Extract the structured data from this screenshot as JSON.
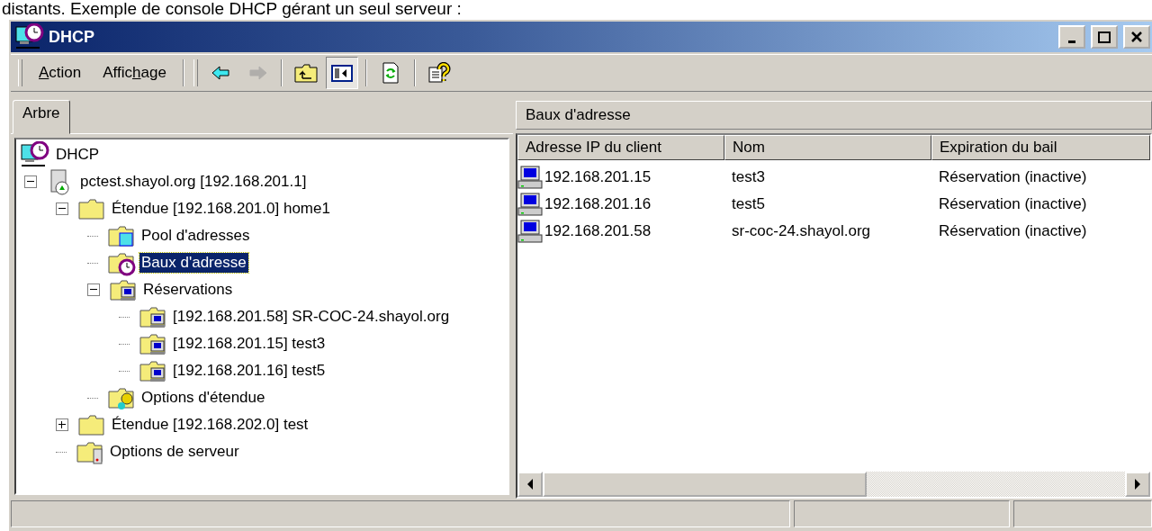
{
  "caption": "distants. Exemple de console DHCP gérant un seul serveur :",
  "window": {
    "title": "DHCP",
    "controls": [
      {
        "kind": "minimize"
      },
      {
        "kind": "maximize"
      },
      {
        "kind": "close"
      }
    ]
  },
  "menu": [
    {
      "key": "A",
      "after": "ction"
    },
    {
      "before": "Affic",
      "key": "h",
      "after": "age"
    }
  ],
  "toolbar": [
    {
      "buttons": [
        {
          "kind": "back",
          "disabled": false,
          "pressed": false
        },
        {
          "kind": "forward",
          "disabled": true,
          "pressed": false
        }
      ]
    },
    {
      "buttons": [
        {
          "kind": "up",
          "disabled": false,
          "pressed": false
        },
        {
          "kind": "tree-toggle",
          "disabled": false,
          "pressed": true
        }
      ]
    },
    {
      "buttons": [
        {
          "kind": "refresh",
          "disabled": false,
          "pressed": false
        }
      ]
    },
    {
      "buttons": [
        {
          "kind": "help",
          "disabled": false,
          "pressed": false
        }
      ]
    }
  ],
  "tabs": [
    {
      "label": "Arbre",
      "selected": true
    }
  ],
  "tree": [
    {
      "label": "DHCP",
      "kind": "dhcp",
      "selected": false,
      "children": [
        {
          "label": "pctest.shayol.org [192.168.201.1]",
          "kind": "server",
          "selected": false,
          "expanded": true,
          "children": [
            {
              "label": "Étendue [192.168.201.0] home1",
              "kind": "folder",
              "selected": false,
              "expanded": true,
              "children": [
                {
                  "label": "Pool d'adresses",
                  "kind": "pool",
                  "selected": false
                },
                {
                  "label": "Baux d'adresse",
                  "kind": "leases",
                  "selected": true
                },
                {
                  "label": "Réservations",
                  "kind": "reservations",
                  "selected": false,
                  "expanded": true,
                  "children": [
                    {
                      "label": "[192.168.201.58] SR-COC-24.shayol.org",
                      "kind": "reservation",
                      "selected": false
                    },
                    {
                      "label": "[192.168.201.15] test3",
                      "kind": "reservation",
                      "selected": false
                    },
                    {
                      "label": "[192.168.201.16] test5",
                      "kind": "reservation",
                      "selected": false
                    }
                  ]
                },
                {
                  "label": "Options d'étendue",
                  "kind": "options",
                  "selected": false
                }
              ]
            },
            {
              "label": "Étendue [192.168.202.0] test",
              "kind": "folder",
              "selected": false,
              "expanded": false
            },
            {
              "label": "Options de serveur",
              "kind": "server-options",
              "selected": false
            }
          ]
        }
      ]
    }
  ],
  "details": {
    "title": "Baux d'adresse",
    "columns": [
      "Adresse IP du client",
      "Nom",
      "Expiration du bail"
    ],
    "rows": [
      {
        "ip": "192.168.201.15",
        "name": "test3",
        "expiration": "Réservation (inactive)"
      },
      {
        "ip": "192.168.201.16",
        "name": "test5",
        "expiration": "Réservation (inactive)"
      },
      {
        "ip": "192.168.201.58",
        "name": "sr-coc-24.shayol.org",
        "expiration": "Réservation (inactive)"
      }
    ]
  }
}
